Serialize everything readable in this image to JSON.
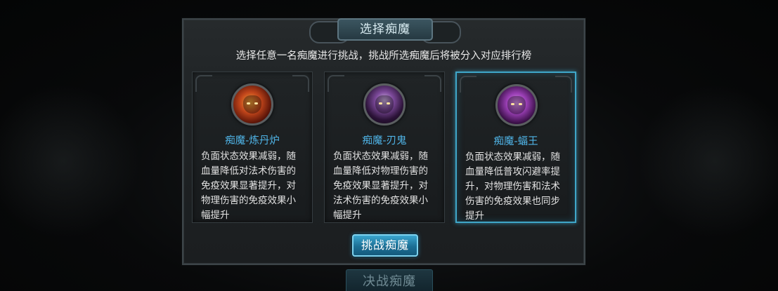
{
  "dialog": {
    "title": "选择痴魔",
    "subtitle": "选择任意一名痴魔进行挑战，挑战所选痴魔后将被分入对应排行榜",
    "cards": [
      {
        "name": "痴魔-炼丹炉",
        "description": "负面状态效果减弱，随血量降低对法术伤害的免疫效果显著提升，对物理伤害的免疫效果小幅提升",
        "selected": false
      },
      {
        "name": "痴魔-刃鬼",
        "description": "负面状态效果减弱，随血量降低对物理伤害的免疫效果显著提升，对法术伤害的免疫效果小幅提升",
        "selected": false
      },
      {
        "name": "痴魔-蝠王",
        "description": "负面状态效果减弱，随血量降低普攻闪避率提升，对物理伤害和法术伤害的免疫效果也同步提升",
        "selected": true
      }
    ],
    "challenge_button": "挑战痴魔"
  },
  "background": {
    "under_button": "决战痴魔"
  },
  "colors": {
    "accent": "#3fa6c8",
    "name_text": "#4fb3e6",
    "button": "#1c6f95"
  }
}
